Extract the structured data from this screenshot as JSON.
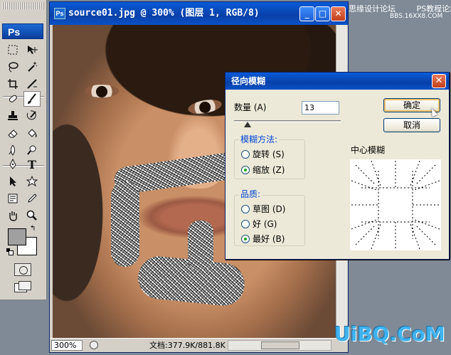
{
  "document": {
    "title": "source01.jpg @ 300% (图层 1, RGB/8)",
    "zoom": "300%",
    "doc_info": "文档:377.9K/881.8K",
    "icon_label": "Ps"
  },
  "tools": {
    "logo": "Ps",
    "type_tool_glyph": "T"
  },
  "dialog": {
    "title": "径向模糊",
    "amount_label": "数量 (A)",
    "amount_value": "13",
    "ok_label": "确定",
    "cancel_label": "取消",
    "blur_method": {
      "title": "模糊方法:",
      "options": [
        "旋转 (S)",
        "缩放 (Z)"
      ],
      "selected": "缩放 (Z)"
    },
    "quality": {
      "title": "品质:",
      "options": [
        "草图 (D)",
        "好 (G)",
        "最好 (B)"
      ],
      "selected": "最好 (B)"
    },
    "center_label": "中心模糊"
  },
  "watermarks": {
    "top_left_text": "思缘设计论坛",
    "top_right_text": "PS教程论坛",
    "top_url": "BBS.16XX8.COM",
    "bottom_right": "UiBQ.CoM"
  },
  "colors": {
    "titlebar": "#0840a8",
    "dialog_bg": "#ece9d8",
    "foreground_swatch": "#a0a0a0",
    "background_swatch": "#ffffff"
  }
}
